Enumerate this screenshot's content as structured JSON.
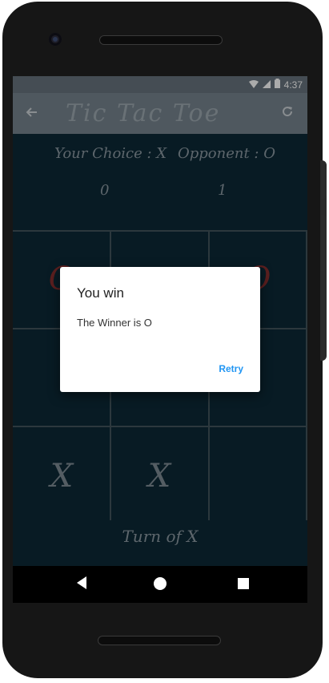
{
  "status_bar": {
    "time": "4:37",
    "icons": [
      "wifi-icon",
      "signal-icon",
      "battery-icon"
    ]
  },
  "app_bar": {
    "title": "Tic Tac Toe",
    "back_icon": "arrow-back-icon",
    "refresh_icon": "refresh-icon"
  },
  "scoreboard": {
    "player_label": "Your Choice : X",
    "opponent_label": "Opponent : O",
    "player_score": "0",
    "opponent_score": "1"
  },
  "board": {
    "cells": [
      "O",
      "",
      "O",
      "",
      "",
      "",
      "X",
      "X",
      ""
    ]
  },
  "turn_text": "Turn of X",
  "dialog": {
    "title": "You win",
    "message": "The Winner is O",
    "button_label": "Retry"
  },
  "colors": {
    "background": "#0b2530",
    "app_bar": "#6a767f",
    "accent": "#2196f3",
    "o_mark": "#7a2a2a"
  }
}
